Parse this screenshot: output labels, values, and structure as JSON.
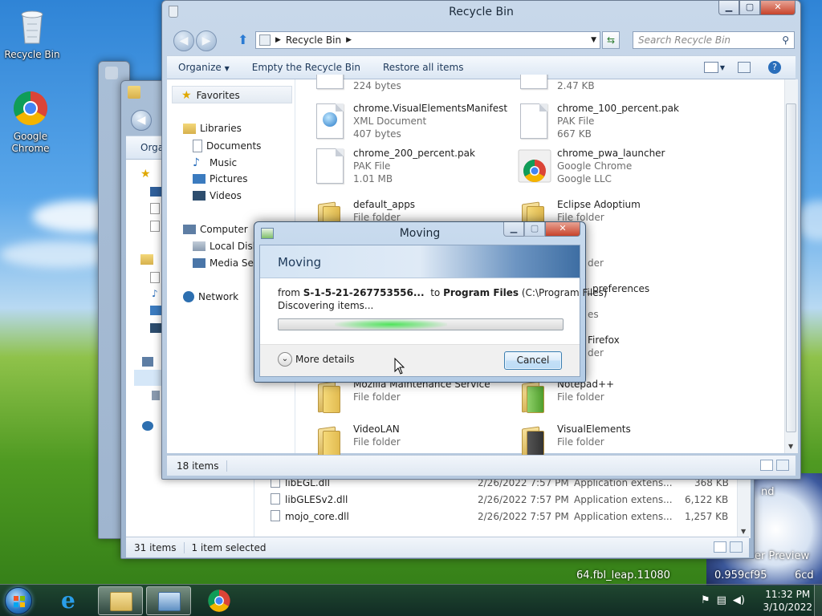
{
  "desktop": {
    "icons": [
      {
        "label": "Recycle Bin",
        "icon": "recycle-bin-icon"
      },
      {
        "label": "Google\nChrome",
        "icon": "chrome-icon"
      }
    ],
    "watermark_line1": "er Preview",
    "watermark_line2": "64.fbl_leap.11080",
    "watermark_line3": "0.959cf95",
    "watermark_line4": "6cd",
    "watermark_partial": "nd"
  },
  "recycle_window": {
    "title": "Recycle Bin",
    "address": "Recycle Bin",
    "search_placeholder": "Search Recycle Bin",
    "toolbar": {
      "organize": "Organize",
      "empty": "Empty the Recycle Bin",
      "restore": "Restore all items"
    },
    "nav": {
      "favorites": "Favorites",
      "libraries": "Libraries",
      "documents": "Documents",
      "music": "Music",
      "pictures": "Pictures",
      "videos": "Videos",
      "computer": "Computer",
      "local_disk": "Local Disk",
      "media_server": "Media Serv",
      "network": "Network"
    },
    "items": [
      {
        "name": "",
        "type": "",
        "size": "224 bytes",
        "icon": "file-icon"
      },
      {
        "name": "",
        "type": "",
        "size": "2.47 KB",
        "icon": "file-icon"
      },
      {
        "name": "chrome.VisualElementsManifest",
        "type": "XML Document",
        "size": "407 bytes",
        "icon": "xml-document-icon"
      },
      {
        "name": "chrome_100_percent.pak",
        "type": "PAK File",
        "size": "667 KB",
        "icon": "file-icon"
      },
      {
        "name": "chrome_200_percent.pak",
        "type": "PAK File",
        "size": "1.01 MB",
        "icon": "file-icon"
      },
      {
        "name": "chrome_pwa_launcher",
        "type": "Google Chrome",
        "size": "Google LLC",
        "icon": "chrome-icon"
      },
      {
        "name": "default_apps",
        "type": "File folder",
        "size": "",
        "icon": "folder-icon"
      },
      {
        "name": "Eclipse Adoptium",
        "type": "File folder",
        "size": "",
        "icon": "folder-icon"
      },
      {
        "name": "Mozilla Maintenance Service",
        "type": "File folder",
        "size": "",
        "icon": "folder-icon"
      },
      {
        "name": "Notepad++",
        "type": "File folder",
        "size": "",
        "icon": "folder-icon"
      },
      {
        "name": "VideoLAN",
        "type": "File folder",
        "size": "",
        "icon": "folder-icon"
      },
      {
        "name": "VisualElements",
        "type": "File folder",
        "size": "",
        "icon": "folder-icon"
      }
    ],
    "hidden_fragments": {
      "frag1": "der",
      "frag2": "_preferences",
      "frag3": "es",
      "frag4": "Firefox",
      "frag5": "der"
    },
    "status": "18 items"
  },
  "back_window": {
    "organize": "Orga",
    "rows": [
      {
        "name": "libEGL.dll",
        "date": "2/26/2022 7:57 PM",
        "type": "Application extens...",
        "size": "368 KB"
      },
      {
        "name": "libGLESv2.dll",
        "date": "2/26/2022 7:57 PM",
        "type": "Application extens...",
        "size": "6,122 KB"
      },
      {
        "name": "mojo_core.dll",
        "date": "2/26/2022 7:57 PM",
        "type": "Application extens...",
        "size": "1,257 KB"
      }
    ],
    "status_items": "31 items",
    "status_selected": "1 item selected"
  },
  "dialog": {
    "title": "Moving",
    "header": "Moving",
    "from_label": "from",
    "source": "S-1-5-21-267753556...",
    "to_label": "to",
    "destination": "Program Files",
    "destination_path": "(C:\\Program Files)",
    "status": "Discovering items...",
    "more_details": "More details",
    "cancel": "Cancel"
  },
  "taskbar": {
    "time": "11:32 PM",
    "date": "3/10/2022"
  },
  "colors": {
    "accent": "#3c7fb1",
    "progress_glow": "#4ee45a"
  }
}
